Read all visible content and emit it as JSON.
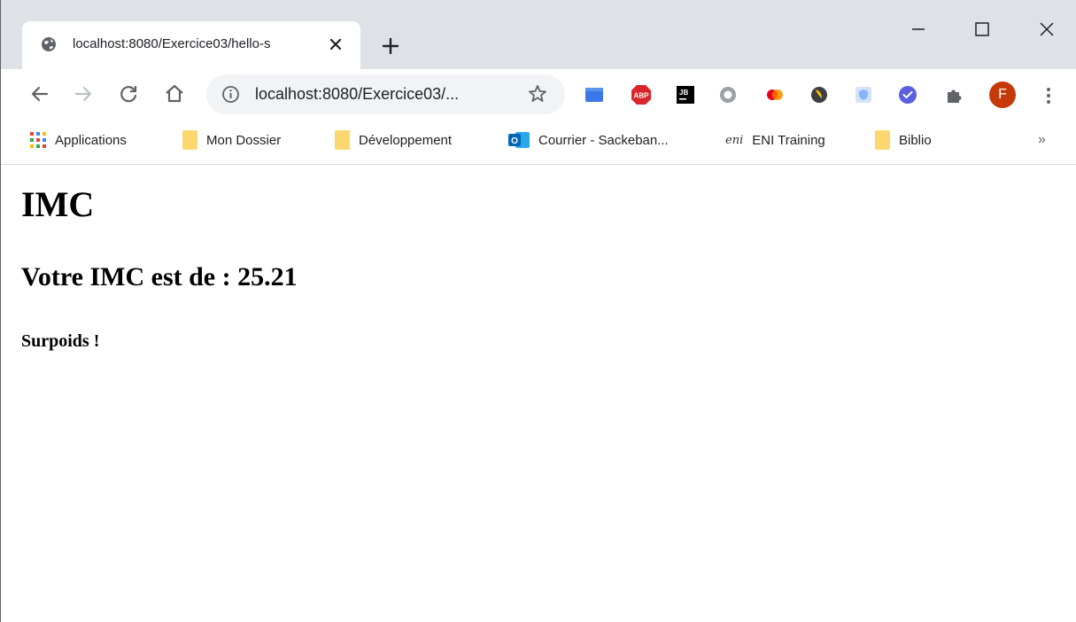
{
  "tab": {
    "title": "localhost:8080/Exercice03/hello-s",
    "icon": "globe-icon"
  },
  "toolbar": {
    "url": "localhost:8080/Exercice03/...",
    "avatar_letter": "F",
    "extensions": [
      "blue-extension-icon",
      "adblock-plus-icon",
      "jetbrains-icon",
      "circle-extension-icon",
      "mastercard-icon",
      "moon-extension-icon",
      "shield-extension-icon",
      "check-extension-icon",
      "puzzle-icon"
    ]
  },
  "bookmarks": {
    "items": [
      {
        "label": "Applications",
        "icon": "apps-grid-icon"
      },
      {
        "label": "Mon Dossier",
        "icon": "folder-icon"
      },
      {
        "label": "Développement",
        "icon": "folder-icon"
      },
      {
        "label": "Courrier - Sackeban...",
        "icon": "outlook-icon"
      },
      {
        "label": "ENI Training",
        "icon": "eni-logo-icon",
        "logo_text": "eni"
      },
      {
        "label": "Biblio",
        "icon": "folder-icon"
      }
    ],
    "more_label": "»"
  },
  "page": {
    "heading": "IMC",
    "result_label": "Votre IMC est de : 25.21",
    "status": "Surpoids !"
  },
  "colors": {
    "tabstrip": "#dee1e6",
    "omnibox": "#f1f3f4",
    "avatar": "#c5390b",
    "folder": "#fcd770"
  }
}
